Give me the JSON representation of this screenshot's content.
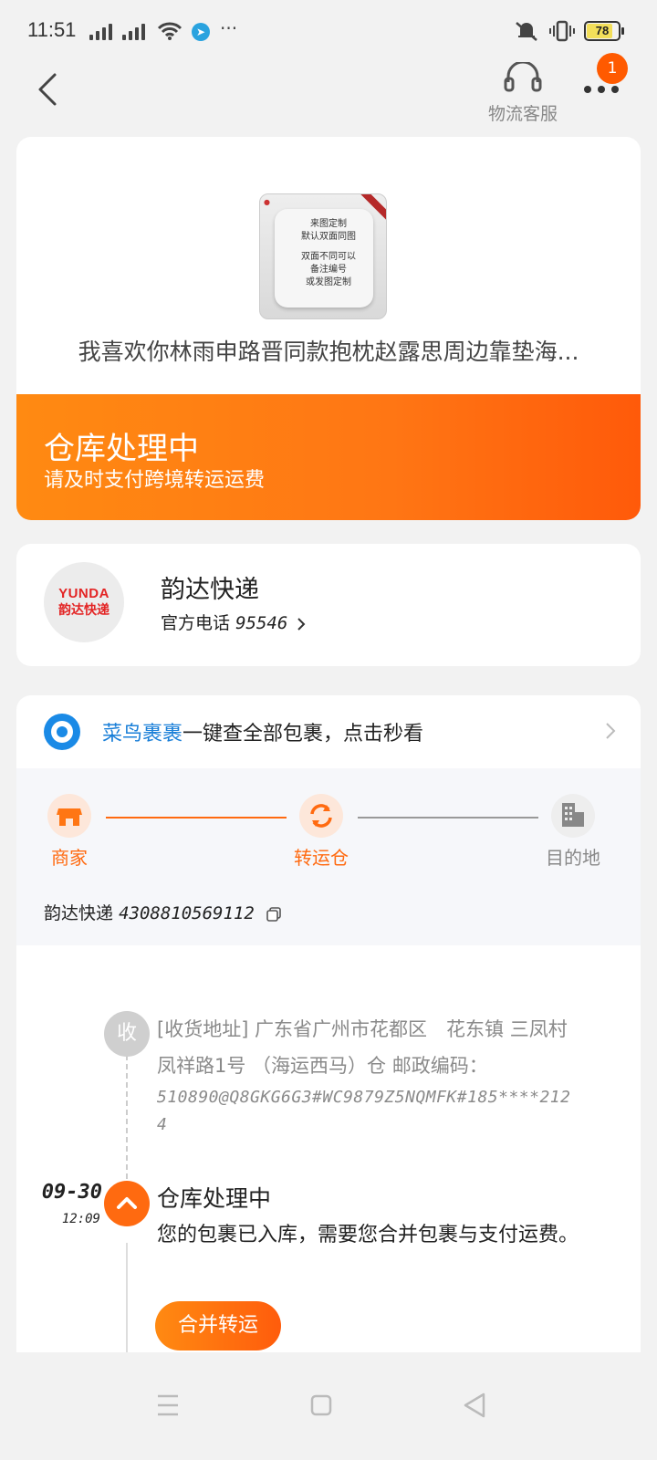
{
  "status_bar": {
    "time": "11:51",
    "battery": "78",
    "more": "···"
  },
  "nav": {
    "service_label": "物流客服",
    "badge_count": "1"
  },
  "product": {
    "title": "我喜欢你林雨申路晋同款抱枕赵露思周边靠垫海...",
    "image_lines": [
      "来图定制",
      "默认双面同图",
      "双面不同可以",
      "备注编号",
      "或发图定制"
    ]
  },
  "status": {
    "main": "仓库处理中",
    "sub": "请及时支付跨境转运运费"
  },
  "courier": {
    "name": "韵达快递",
    "phone_label": "官方电话",
    "phone_number": "95546",
    "logo_top": "YUNDA",
    "logo_bottom": "韵达快递"
  },
  "cainiao": {
    "brand": "菜鸟裹裹",
    "text": "一键查全部包裹，点击秒看"
  },
  "progress": {
    "steps": [
      {
        "label": "商家",
        "state": "done"
      },
      {
        "label": "转运仓",
        "state": "current"
      },
      {
        "label": "目的地",
        "state": "pending"
      }
    ],
    "tracking_label": "韵达快递",
    "tracking_number": "4308810569112"
  },
  "timeline": {
    "receive_icon": "收",
    "address": "[收货地址] 广东省广州市花都区　花东镇 三凤村凤祥路1号 （海运西马）仓 邮政编码：",
    "address_code": "510890@Q8GKG6G3#WC9879Z5NQMFK#185****2124",
    "event_date": "09-30",
    "event_time": "12:09",
    "event_title": "仓库处理中",
    "event_desc": "您的包裹已入库，需要您合并包裹与支付运费。",
    "action_label": "合并转运"
  },
  "colors": {
    "accent": "#ff7614",
    "cainiao_blue": "#1a8ae6",
    "yunda_red": "#e32424"
  }
}
